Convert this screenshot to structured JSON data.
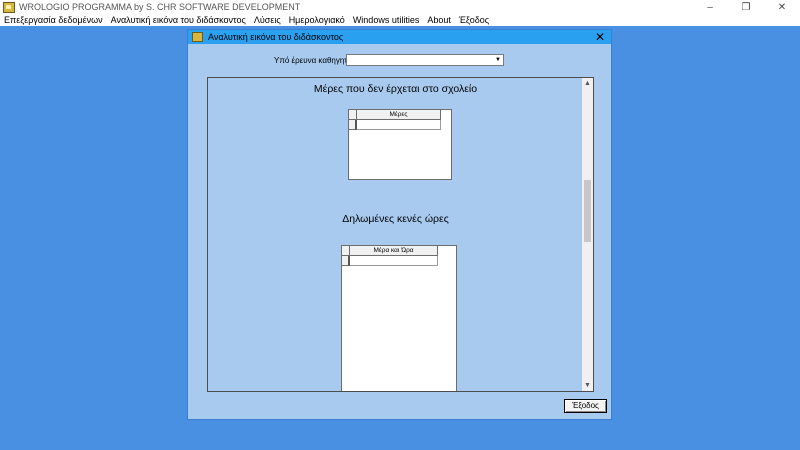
{
  "app": {
    "title": "WROLOGIO PROGRAMMA by S. CHR SOFTWARE DEVELOPMENT",
    "window_controls": [
      "–",
      "❐",
      "✕"
    ]
  },
  "menubar": {
    "items": [
      "Επεξεργασία δεδομένων",
      "Αναλυτική εικόνα του διδάσκοντος",
      "Λύσεις",
      "Ημερολογιακό",
      "Windows utilities",
      "About",
      "Έξοδος"
    ]
  },
  "dialog": {
    "title": "Αναλυτική εικόνα του διδάσκοντος",
    "close_glyph": "✕",
    "teacher_label": "Υπό έρευνα καθηγητής:",
    "teacher_value": "",
    "dropdown_glyph": "▼",
    "section1": {
      "title": "Μέρες που δεν έρχεται στο σχολείο",
      "column": "Μέρες"
    },
    "section2": {
      "title": "Δηλωμένες κενές ώρες",
      "column": "Μέρα και Ώρα"
    },
    "scroll_up_glyph": "▲",
    "scroll_down_glyph": "▼",
    "exit_button": "Έξοδος"
  }
}
